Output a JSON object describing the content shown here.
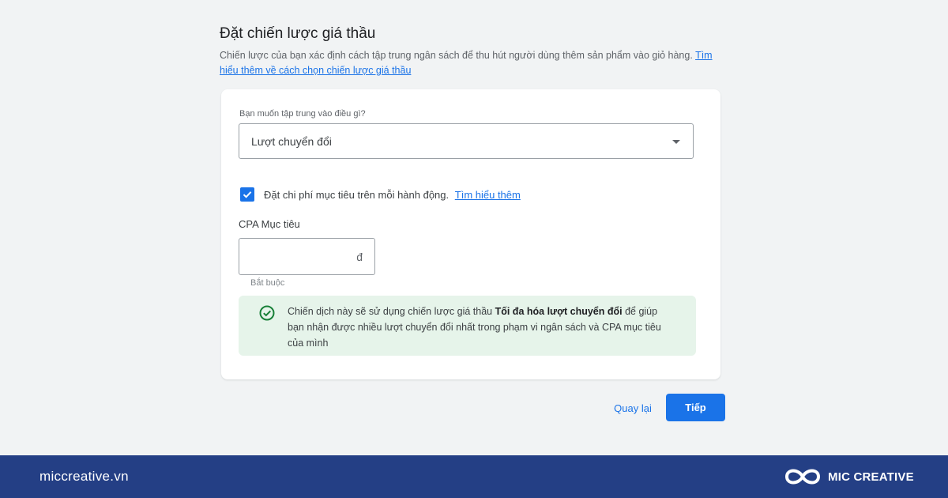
{
  "header": {
    "title": "Đặt chiến lược giá thầu",
    "description": "Chiến lược của bạn xác định cách tập trung ngân sách để thu hút người dùng thêm sản phẩm vào giỏ hàng.",
    "learn_more_link": "Tìm hiểu thêm về cách chọn chiến lược giá thầu"
  },
  "form": {
    "focus_label": "Bạn muốn tập trung vào điều gì?",
    "focus_value": "Lượt chuyển đổi",
    "target_cost_checkbox": {
      "checked": true,
      "label": "Đặt chi phí mục tiêu trên mỗi hành động.",
      "link": "Tìm hiểu thêm"
    },
    "cpa_label": "CPA Mục tiêu",
    "cpa_value": "",
    "currency_symbol": "đ",
    "required_hint": "Bắt buộc",
    "info": {
      "before": "Chiến dịch này sẽ sử dụng chiến lược giá thầu ",
      "strategy": "Tối đa hóa lượt chuyển đổi",
      "after": " để giúp bạn nhận được nhiều lượt chuyển đổi nhất trong phạm vi ngân sách và CPA mục tiêu của mình"
    }
  },
  "actions": {
    "back_label": "Quay lại",
    "next_label": "Tiếp"
  },
  "footer": {
    "site": "miccreative.vn",
    "brand": "MIC CREATIVE"
  },
  "icons": {
    "dropdown": "chevron-down-icon",
    "checkbox": "checkmark-icon",
    "info": "check-circle-icon",
    "brand": "infinity-logo-icon"
  },
  "colors": {
    "accent": "#1a73e8",
    "info_background": "#e6f4ea",
    "success": "#188038",
    "footer_background": "#243f85"
  }
}
